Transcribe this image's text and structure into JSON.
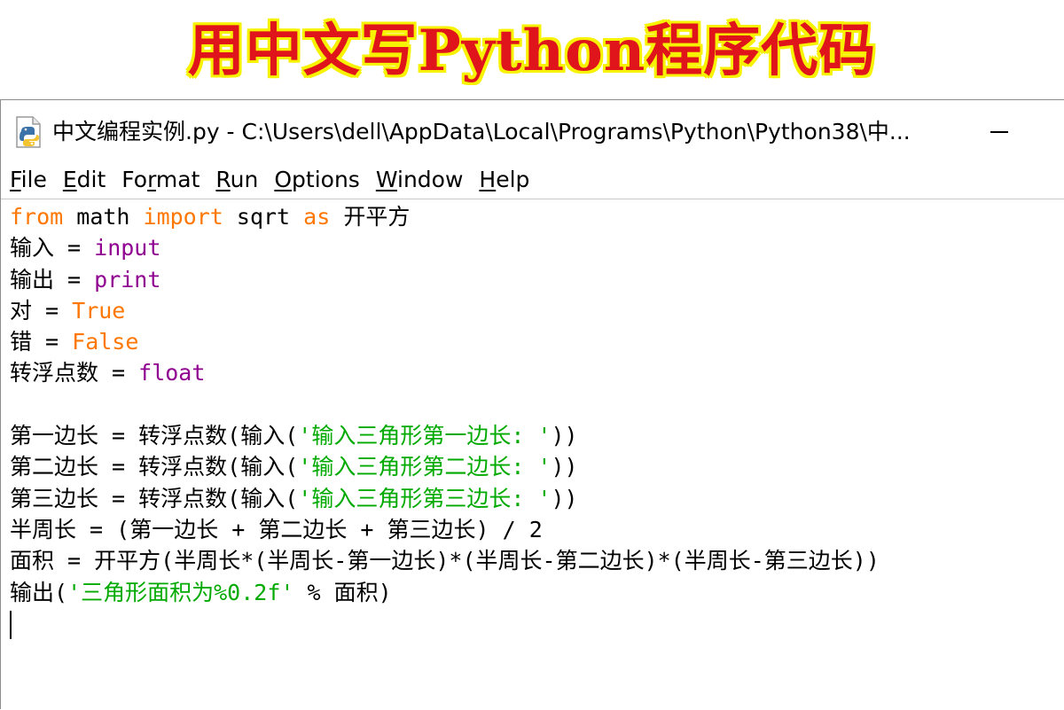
{
  "banner": {
    "title": "用中文写Python程序代码"
  },
  "window": {
    "title": "中文编程实例.py - C:\\Users\\dell\\AppData\\Local\\Programs\\Python\\Python38\\中...",
    "icon": "python-file-icon",
    "minimize_label": "—"
  },
  "menu": {
    "items": [
      {
        "first": "F",
        "rest": "ile"
      },
      {
        "first": "E",
        "rest": "dit"
      },
      {
        "pre": "Fo",
        "first": "r",
        "rest": "mat"
      },
      {
        "first": "R",
        "rest": "un"
      },
      {
        "first": "O",
        "rest": "ptions"
      },
      {
        "first": "W",
        "rest": "indow"
      },
      {
        "first": "H",
        "rest": "elp"
      }
    ]
  },
  "code": {
    "line1": {
      "kw1": "from",
      "t1": " math ",
      "kw2": "import",
      "t2": " sqrt ",
      "kw3": "as",
      "t3": " 开平方"
    },
    "line2": {
      "t1": "输入 = ",
      "bi": "input"
    },
    "line3": {
      "t1": "输出 = ",
      "bi": "print"
    },
    "line4": {
      "t1": "对 = ",
      "kw": "True"
    },
    "line5": {
      "t1": "错 = ",
      "kw": "False"
    },
    "line6": {
      "t1": "转浮点数 = ",
      "bi": "float"
    },
    "line7": {
      "t1": ""
    },
    "line8": {
      "t1": "第一边长 = 转浮点数(输入(",
      "str": "'输入三角形第一边长: '",
      "t2": "))"
    },
    "line9": {
      "t1": "第二边长 = 转浮点数(输入(",
      "str": "'输入三角形第二边长: '",
      "t2": "))"
    },
    "line10": {
      "t1": "第三边长 = 转浮点数(输入(",
      "str": "'输入三角形第三边长: '",
      "t2": "))"
    },
    "line11": {
      "t1": "半周长 = (第一边长 + 第二边长 + 第三边长) / 2"
    },
    "line12": {
      "t1": "面积 = 开平方(半周长*(半周长-第一边长)*(半周长-第二边长)*(半周长-第三边长))"
    },
    "line13": {
      "t1": "输出(",
      "str": "'三角形面积为%0.2f'",
      "t2": " % 面积)"
    }
  },
  "colors": {
    "keyword": "#ff7700",
    "builtin": "#900090",
    "string": "#00aa00",
    "banner_text": "#e0141b",
    "banner_outline": "#f7f200"
  }
}
